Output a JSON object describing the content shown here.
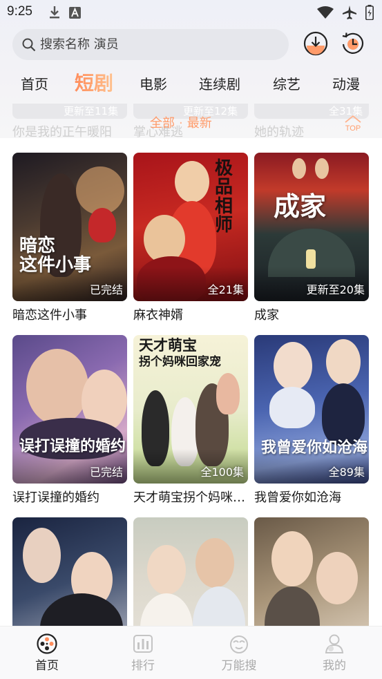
{
  "status": {
    "time": "9:25"
  },
  "search": {
    "placeholder": "搜索名称 演员"
  },
  "tabs": [
    {
      "label": "首页"
    },
    {
      "label": "短剧",
      "active": true
    },
    {
      "label": "电影"
    },
    {
      "label": "连续剧"
    },
    {
      "label": "综艺"
    },
    {
      "label": "动漫"
    }
  ],
  "sub_strip": {
    "episodes": [
      "更新至11集",
      "更新至12集",
      "全31集"
    ],
    "titles": [
      "你是我的正午暖阳",
      "掌心难逃",
      "她的轨迹"
    ],
    "filter": {
      "all": "全部",
      "separator": "·",
      "latest": "最新"
    },
    "top_label": "TOP"
  },
  "cards": [
    {
      "title": "暗恋这件小事",
      "badge": "已完结",
      "art_text": "暗恋\n这件小事"
    },
    {
      "title": "麻衣神婿",
      "badge": "全21集",
      "art_text": "极品相师"
    },
    {
      "title": "成家",
      "badge": "更新至20集",
      "art_text": "成家"
    },
    {
      "title": "误打误撞的婚约",
      "badge": "已完结",
      "art_text": "误打误撞的婚约"
    },
    {
      "title": "天才萌宝拐个妈咪回家宠",
      "badge": "全100集",
      "art_text": "天才萌宝\n拐个妈咪回家宠"
    },
    {
      "title": "我曾爱你如沧海",
      "badge": "全89集",
      "art_text": "我曾爱你如沧海"
    },
    {
      "title": "",
      "badge": ""
    },
    {
      "title": "",
      "badge": ""
    },
    {
      "title": "",
      "badge": ""
    }
  ],
  "bottom_nav": [
    {
      "label": "首页",
      "icon": "film-reel-icon",
      "active": true
    },
    {
      "label": "排行",
      "icon": "ranking-icon"
    },
    {
      "label": "万能搜",
      "icon": "search-mascot-icon"
    },
    {
      "label": "我的",
      "icon": "profile-icon"
    }
  ],
  "colors": {
    "accent": "#ff9b6a",
    "tab_gradient_start": "#ff8d5c",
    "tab_gradient_end": "#ffc08c"
  }
}
